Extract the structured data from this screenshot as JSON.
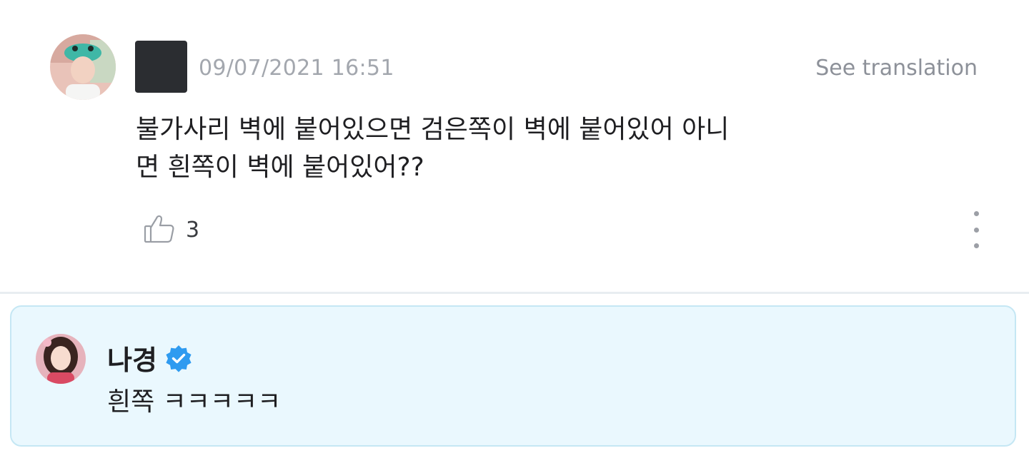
{
  "comment": {
    "timestamp": "09/07/2021 16:51",
    "see_translation": "See translation",
    "body_line1": "불가사리 벽에 붙어있으면 검은쪽이 벽에 붙어있어 아니",
    "body_line2": "면 흰쪽이 벽에 붙어있어??",
    "like_icon": "thumbs-up-icon",
    "like_count": "3",
    "more_icon": "more-vertical-icon"
  },
  "reply": {
    "author": "나경",
    "verified_icon": "verified-badge-icon",
    "text": "흰쪽 ㅋㅋㅋㅋㅋ"
  },
  "colors": {
    "reply_background": "#eaf8fe",
    "reply_border": "#c5e7f4",
    "verified_blue": "#2f9bf0",
    "muted_text": "#a3a7ae"
  }
}
